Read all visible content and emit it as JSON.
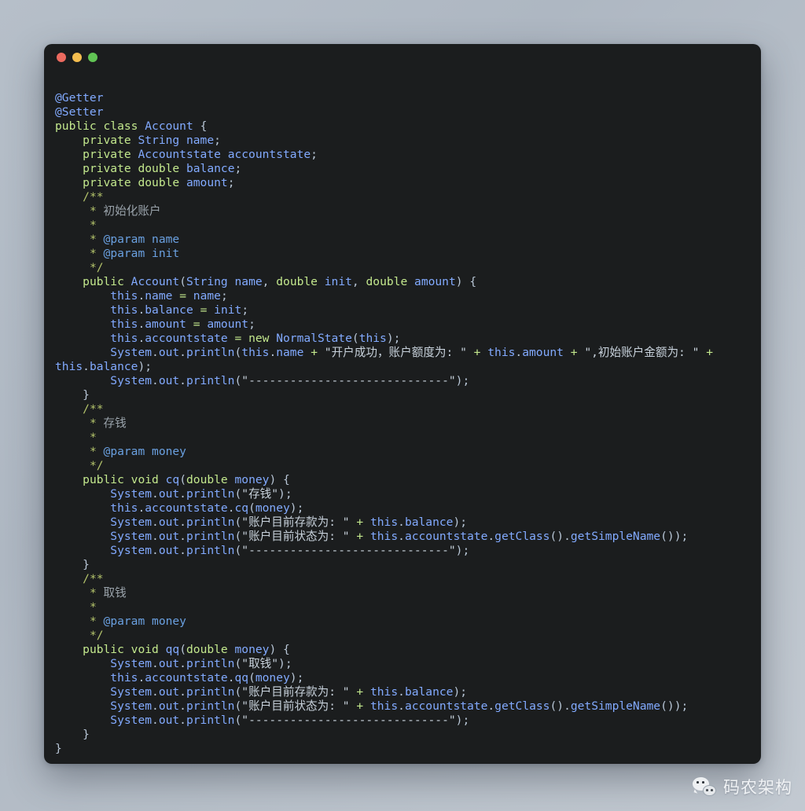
{
  "window": {
    "traffic_lights": [
      {
        "name": "close-button",
        "color": "#ec6a5f"
      },
      {
        "name": "minimize-button",
        "color": "#f4bd4f"
      },
      {
        "name": "maximize-button",
        "color": "#61c454"
      }
    ],
    "background": "#1b1d1e"
  },
  "theme": {
    "keyword": "#c3e88d",
    "identifier": "#82aaff",
    "string": "#c8d2dc",
    "comment": "#b4c46b",
    "comment_text": "#9aa3ab",
    "param_tag": "#6aa0e0",
    "plain": "#b8c6d6",
    "page_background": "#b6bfc9"
  },
  "code": {
    "language": "java",
    "lines": [
      "@Getter",
      "@Setter",
      "public class Account {",
      "    private String name;",
      "    private Accountstate accountstate;",
      "    private double balance;",
      "    private double amount;",
      "    /**",
      "     * 初始化账户",
      "     *",
      "     * @param name",
      "     * @param init",
      "     */",
      "    public Account(String name, double init, double amount) {",
      "        this.name = name;",
      "        this.balance = init;",
      "        this.amount = amount;",
      "        this.accountstate = new NormalState(this);",
      "        System.out.println(this.name + \"开户成功，账户额度为: \" + this.amount + \",初始账户金额为: \" + this.balance);",
      "        System.out.println(\"-----------------------------\");",
      "    }",
      "    /**",
      "     * 存钱",
      "     *",
      "     * @param money",
      "     */",
      "    public void cq(double money) {",
      "        System.out.println(\"存钱\");",
      "        this.accountstate.cq(money);",
      "        System.out.println(\"账户目前存款为: \" + this.balance);",
      "        System.out.println(\"账户目前状态为: \" + this.accountstate.getClass().getSimpleName());",
      "        System.out.println(\"-----------------------------\");",
      "    }",
      "    /**",
      "     * 取钱",
      "     *",
      "     * @param money",
      "     */",
      "    public void qq(double money) {",
      "        System.out.println(\"取钱\");",
      "        this.accountstate.qq(money);",
      "        System.out.println(\"账户目前存款为: \" + this.balance);",
      "        System.out.println(\"账户目前状态为: \" + this.accountstate.getClass().getSimpleName());",
      "        System.out.println(\"-----------------------------\");",
      "    }",
      "}"
    ]
  },
  "watermark": {
    "icon": "wechat-icon",
    "label": "码农架构"
  }
}
